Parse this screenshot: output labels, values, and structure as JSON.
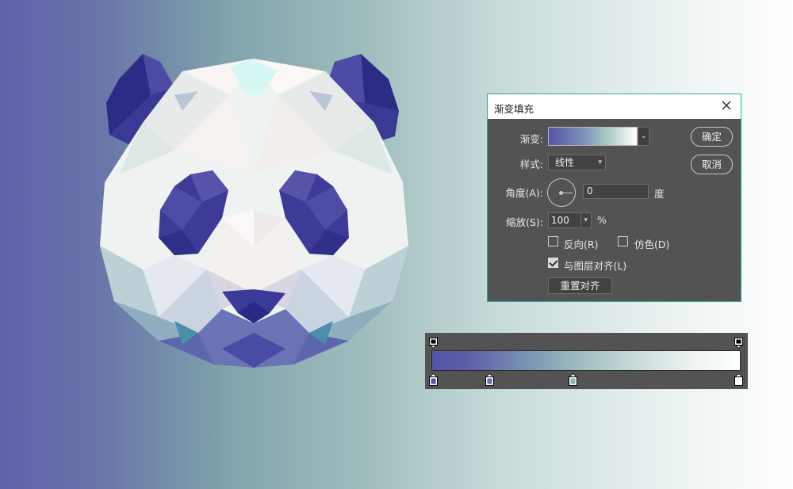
{
  "dialog": {
    "title": "渐变填充",
    "gradient_label": "渐变:",
    "style_label": "样式:",
    "style_value": "线性",
    "angle_label": "角度(A):",
    "angle_value": "0",
    "angle_unit": "度",
    "scale_label": "缩放(S):",
    "scale_value": "100",
    "scale_unit": "%",
    "reverse_label": "反向(R)",
    "reverse_checked": false,
    "dither_label": "仿色(D)",
    "dither_checked": false,
    "align_label": "与图层对齐(L)",
    "align_checked": true,
    "reset_align_label": "重置对齐",
    "ok_label": "确定",
    "cancel_label": "取消",
    "icons": {
      "close": "close-icon",
      "dropdown": "chevron-down-icon",
      "angle": "angle-dial-icon"
    }
  },
  "gradient_editor": {
    "opacity_stops": 2,
    "color_stops": 4,
    "colors": [
      "#5654a7",
      "#6b6cab",
      "#8faeb4",
      "#ffffff"
    ]
  },
  "colors": {
    "dialog_bg": "#535353",
    "dialog_border": "#3aa59a",
    "panda_dark": "#3b3a96",
    "panda_light": "#f6f4f2"
  }
}
